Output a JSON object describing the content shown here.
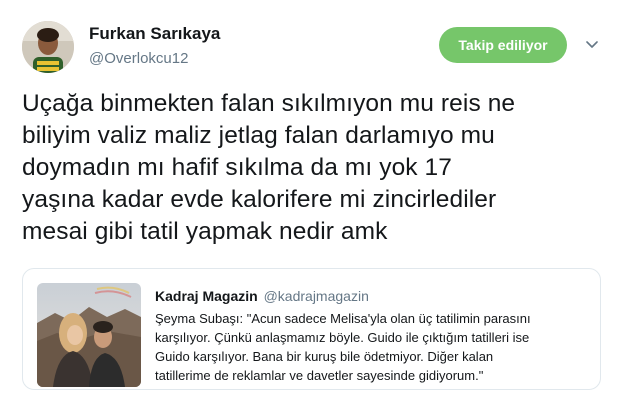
{
  "author": {
    "name": "Furkan Sarıkaya",
    "handle": "@Overlokcu12",
    "avatar_icon": "user-photo"
  },
  "follow_button": {
    "label": "Takip ediliyor",
    "color": "#76c66a"
  },
  "menu_icon": "chevron-down-icon",
  "tweet": {
    "lines": [
      "Uçağa binmekten falan sıkılmıyon mu reis ne",
      "biliyim valiz maliz jetlag falan darlamıyo mu",
      "doymadın mı hafif sıkılma da mı yok 17",
      "yaşına kadar evde kalorifere mi zincirlediler",
      "mesai gibi tatil yapmak nedir amk"
    ]
  },
  "quote": {
    "name": "Kadraj Magazin",
    "handle": "@kadrajmagazin",
    "lines": [
      "Şeyma Subaşı: \"Acun sadece Melisa'yla olan üç tatilimin parasını",
      "karşılıyor. Çünkü anlaşmamız böyle. Guido ile çıktığım tatilleri ise",
      "Guido karşılıyor. Bana bir kuruş bile ödetmiyor. Diğer kalan",
      "tatillerime de reklamlar ve davetler sayesinde gidiyorum.\""
    ],
    "media_icon": "couple-photo"
  }
}
